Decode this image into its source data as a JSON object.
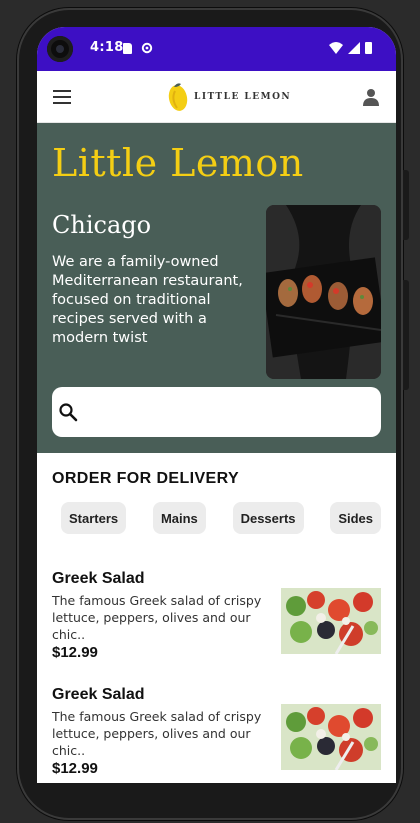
{
  "status_bar": {
    "time": "4:18",
    "colors": {
      "background": "#3d0fc4"
    },
    "icons": [
      "sim-card-icon",
      "settings-gear-icon",
      "wifi-icon",
      "signal-icon",
      "battery-icon"
    ]
  },
  "header": {
    "logo_text": "LITTLE LEMON",
    "icons": [
      "menu-icon",
      "lemon-logo-icon",
      "profile-icon"
    ]
  },
  "hero": {
    "title": "Little Lemon",
    "city": "Chicago",
    "description": "We are a family-owned Mediterranean restaurant, focused on traditional recipes served with a modern twist",
    "search_placeholder": "",
    "colors": {
      "background": "#495e57",
      "title": "#f4ce14"
    }
  },
  "order": {
    "title": "ORDER FOR DELIVERY",
    "categories": [
      "Starters",
      "Mains",
      "Desserts",
      "Sides"
    ]
  },
  "menu_items": [
    {
      "name": "Greek Salad",
      "description": "The famous Greek salad of crispy lettuce, peppers, olives and our chic..",
      "price": "$12.99"
    },
    {
      "name": "Greek Salad",
      "description": "The famous Greek salad of crispy lettuce, peppers, olives and our chic..",
      "price": "$12.99"
    }
  ]
}
